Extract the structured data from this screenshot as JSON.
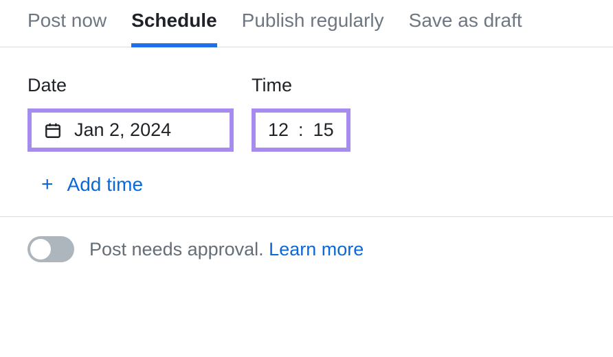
{
  "tabs": {
    "post_now": "Post now",
    "schedule": "Schedule",
    "publish_regularly": "Publish regularly",
    "save_as_draft": "Save as draft"
  },
  "labels": {
    "date": "Date",
    "time": "Time"
  },
  "date_value": "Jan 2, 2024",
  "time": {
    "hour": "12",
    "sep": ":",
    "minute": "15"
  },
  "add_time_label": "Add time",
  "approval": {
    "text": "Post needs approval. ",
    "learn_more": "Learn more"
  },
  "colors": {
    "highlight_border": "#a78cf0",
    "link": "#0969da",
    "tab_underline": "#1f6feb"
  }
}
